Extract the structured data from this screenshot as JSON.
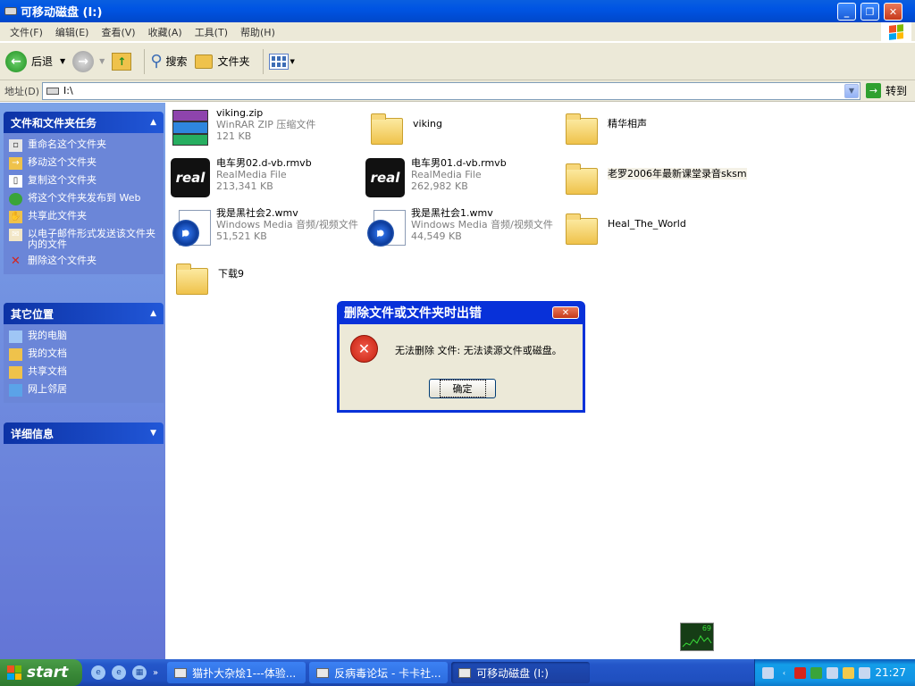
{
  "window": {
    "title": "可移动磁盘 (I:)",
    "caption_buttons": [
      "_",
      "❐",
      "✕"
    ]
  },
  "menu": [
    "文件(F)",
    "编辑(E)",
    "查看(V)",
    "收藏(A)",
    "工具(T)",
    "帮助(H)"
  ],
  "toolbar": {
    "back": "后退",
    "search": "搜索",
    "folders": "文件夹"
  },
  "address": {
    "label": "地址(D)",
    "value": "I:\\",
    "go": "转到"
  },
  "sidebar": {
    "tasks": {
      "title": "文件和文件夹任务",
      "items": [
        "重命名这个文件夹",
        "移动这个文件夹",
        "复制这个文件夹",
        "将这个文件夹发布到 Web",
        "共享此文件夹",
        "以电子邮件形式发送该文件夹内的文件",
        "删除这个文件夹"
      ]
    },
    "places": {
      "title": "其它位置",
      "items": [
        "我的电脑",
        "我的文档",
        "共享文档",
        "网上邻居"
      ]
    },
    "details": {
      "title": "详细信息"
    }
  },
  "files": [
    {
      "name": "viking.zip",
      "type": "WinRAR ZIP 压缩文件",
      "size": "121 KB",
      "icon": "zip-icon"
    },
    {
      "name": "viking",
      "icon": "folder-icon"
    },
    {
      "name": "精华相声",
      "icon": "folder-icon"
    },
    {
      "name": "电车男02.d-vb.rmvb",
      "type": "RealMedia File",
      "size": "213,341 KB",
      "icon": "realplayer-icon"
    },
    {
      "name": "电车男01.d-vb.rmvb",
      "type": "RealMedia File",
      "size": "262,982 KB",
      "icon": "realplayer-icon"
    },
    {
      "name": "老罗2006年最新课堂录音sksm",
      "icon": "folder-icon"
    },
    {
      "name": "我是黑社会2.wmv",
      "type": "Windows Media 音频/视频文件",
      "size": "51,521 KB",
      "icon": "windows-media-icon"
    },
    {
      "name": "我是黑社会1.wmv",
      "type": "Windows Media 音频/视频文件",
      "size": "44,549 KB",
      "icon": "windows-media-icon"
    },
    {
      "name": "Heal_The_World",
      "icon": "folder-icon"
    },
    {
      "name": "下载9",
      "icon": "folder-icon"
    }
  ],
  "dialog": {
    "title": "删除文件或文件夹时出错",
    "message": "无法删除 文件: 无法读源文件或磁盘。",
    "ok": "确定"
  },
  "meter": {
    "value": "69"
  },
  "taskbar": {
    "start": "start",
    "tasks": [
      "猫扑大杂烩1---体验...",
      "反病毒论坛 - 卡卡社...",
      "可移动磁盘 (I:)"
    ],
    "active_task": 2,
    "clock": "21:27"
  },
  "colors": {
    "title_blue": "#0054E3",
    "sidebar_blue": "#6375D6",
    "link_blue": "#0B2B9A",
    "taskbar_blue": "#2456C9",
    "start_green": "#3A8A38"
  }
}
